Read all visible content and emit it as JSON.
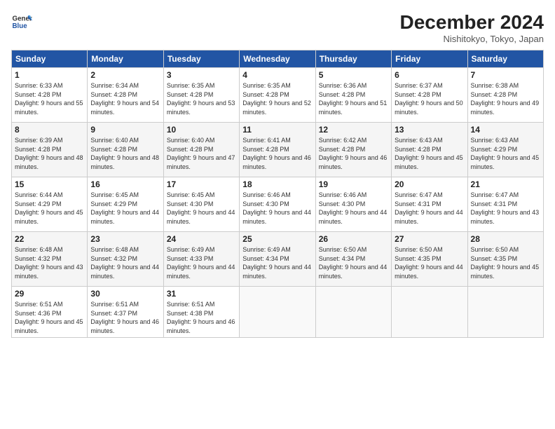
{
  "header": {
    "logo_line1": "General",
    "logo_line2": "Blue",
    "month": "December 2024",
    "location": "Nishitokyo, Tokyo, Japan"
  },
  "weekdays": [
    "Sunday",
    "Monday",
    "Tuesday",
    "Wednesday",
    "Thursday",
    "Friday",
    "Saturday"
  ],
  "weeks": [
    [
      {
        "day": "1",
        "sunrise": "Sunrise: 6:33 AM",
        "sunset": "Sunset: 4:28 PM",
        "daylight": "Daylight: 9 hours and 55 minutes."
      },
      {
        "day": "2",
        "sunrise": "Sunrise: 6:34 AM",
        "sunset": "Sunset: 4:28 PM",
        "daylight": "Daylight: 9 hours and 54 minutes."
      },
      {
        "day": "3",
        "sunrise": "Sunrise: 6:35 AM",
        "sunset": "Sunset: 4:28 PM",
        "daylight": "Daylight: 9 hours and 53 minutes."
      },
      {
        "day": "4",
        "sunrise": "Sunrise: 6:35 AM",
        "sunset": "Sunset: 4:28 PM",
        "daylight": "Daylight: 9 hours and 52 minutes."
      },
      {
        "day": "5",
        "sunrise": "Sunrise: 6:36 AM",
        "sunset": "Sunset: 4:28 PM",
        "daylight": "Daylight: 9 hours and 51 minutes."
      },
      {
        "day": "6",
        "sunrise": "Sunrise: 6:37 AM",
        "sunset": "Sunset: 4:28 PM",
        "daylight": "Daylight: 9 hours and 50 minutes."
      },
      {
        "day": "7",
        "sunrise": "Sunrise: 6:38 AM",
        "sunset": "Sunset: 4:28 PM",
        "daylight": "Daylight: 9 hours and 49 minutes."
      }
    ],
    [
      {
        "day": "8",
        "sunrise": "Sunrise: 6:39 AM",
        "sunset": "Sunset: 4:28 PM",
        "daylight": "Daylight: 9 hours and 48 minutes."
      },
      {
        "day": "9",
        "sunrise": "Sunrise: 6:40 AM",
        "sunset": "Sunset: 4:28 PM",
        "daylight": "Daylight: 9 hours and 48 minutes."
      },
      {
        "day": "10",
        "sunrise": "Sunrise: 6:40 AM",
        "sunset": "Sunset: 4:28 PM",
        "daylight": "Daylight: 9 hours and 47 minutes."
      },
      {
        "day": "11",
        "sunrise": "Sunrise: 6:41 AM",
        "sunset": "Sunset: 4:28 PM",
        "daylight": "Daylight: 9 hours and 46 minutes."
      },
      {
        "day": "12",
        "sunrise": "Sunrise: 6:42 AM",
        "sunset": "Sunset: 4:28 PM",
        "daylight": "Daylight: 9 hours and 46 minutes."
      },
      {
        "day": "13",
        "sunrise": "Sunrise: 6:43 AM",
        "sunset": "Sunset: 4:28 PM",
        "daylight": "Daylight: 9 hours and 45 minutes."
      },
      {
        "day": "14",
        "sunrise": "Sunrise: 6:43 AM",
        "sunset": "Sunset: 4:29 PM",
        "daylight": "Daylight: 9 hours and 45 minutes."
      }
    ],
    [
      {
        "day": "15",
        "sunrise": "Sunrise: 6:44 AM",
        "sunset": "Sunset: 4:29 PM",
        "daylight": "Daylight: 9 hours and 45 minutes."
      },
      {
        "day": "16",
        "sunrise": "Sunrise: 6:45 AM",
        "sunset": "Sunset: 4:29 PM",
        "daylight": "Daylight: 9 hours and 44 minutes."
      },
      {
        "day": "17",
        "sunrise": "Sunrise: 6:45 AM",
        "sunset": "Sunset: 4:30 PM",
        "daylight": "Daylight: 9 hours and 44 minutes."
      },
      {
        "day": "18",
        "sunrise": "Sunrise: 6:46 AM",
        "sunset": "Sunset: 4:30 PM",
        "daylight": "Daylight: 9 hours and 44 minutes."
      },
      {
        "day": "19",
        "sunrise": "Sunrise: 6:46 AM",
        "sunset": "Sunset: 4:30 PM",
        "daylight": "Daylight: 9 hours and 44 minutes."
      },
      {
        "day": "20",
        "sunrise": "Sunrise: 6:47 AM",
        "sunset": "Sunset: 4:31 PM",
        "daylight": "Daylight: 9 hours and 44 minutes."
      },
      {
        "day": "21",
        "sunrise": "Sunrise: 6:47 AM",
        "sunset": "Sunset: 4:31 PM",
        "daylight": "Daylight: 9 hours and 43 minutes."
      }
    ],
    [
      {
        "day": "22",
        "sunrise": "Sunrise: 6:48 AM",
        "sunset": "Sunset: 4:32 PM",
        "daylight": "Daylight: 9 hours and 43 minutes."
      },
      {
        "day": "23",
        "sunrise": "Sunrise: 6:48 AM",
        "sunset": "Sunset: 4:32 PM",
        "daylight": "Daylight: 9 hours and 44 minutes."
      },
      {
        "day": "24",
        "sunrise": "Sunrise: 6:49 AM",
        "sunset": "Sunset: 4:33 PM",
        "daylight": "Daylight: 9 hours and 44 minutes."
      },
      {
        "day": "25",
        "sunrise": "Sunrise: 6:49 AM",
        "sunset": "Sunset: 4:34 PM",
        "daylight": "Daylight: 9 hours and 44 minutes."
      },
      {
        "day": "26",
        "sunrise": "Sunrise: 6:50 AM",
        "sunset": "Sunset: 4:34 PM",
        "daylight": "Daylight: 9 hours and 44 minutes."
      },
      {
        "day": "27",
        "sunrise": "Sunrise: 6:50 AM",
        "sunset": "Sunset: 4:35 PM",
        "daylight": "Daylight: 9 hours and 44 minutes."
      },
      {
        "day": "28",
        "sunrise": "Sunrise: 6:50 AM",
        "sunset": "Sunset: 4:35 PM",
        "daylight": "Daylight: 9 hours and 45 minutes."
      }
    ],
    [
      {
        "day": "29",
        "sunrise": "Sunrise: 6:51 AM",
        "sunset": "Sunset: 4:36 PM",
        "daylight": "Daylight: 9 hours and 45 minutes."
      },
      {
        "day": "30",
        "sunrise": "Sunrise: 6:51 AM",
        "sunset": "Sunset: 4:37 PM",
        "daylight": "Daylight: 9 hours and 46 minutes."
      },
      {
        "day": "31",
        "sunrise": "Sunrise: 6:51 AM",
        "sunset": "Sunset: 4:38 PM",
        "daylight": "Daylight: 9 hours and 46 minutes."
      },
      null,
      null,
      null,
      null
    ]
  ]
}
